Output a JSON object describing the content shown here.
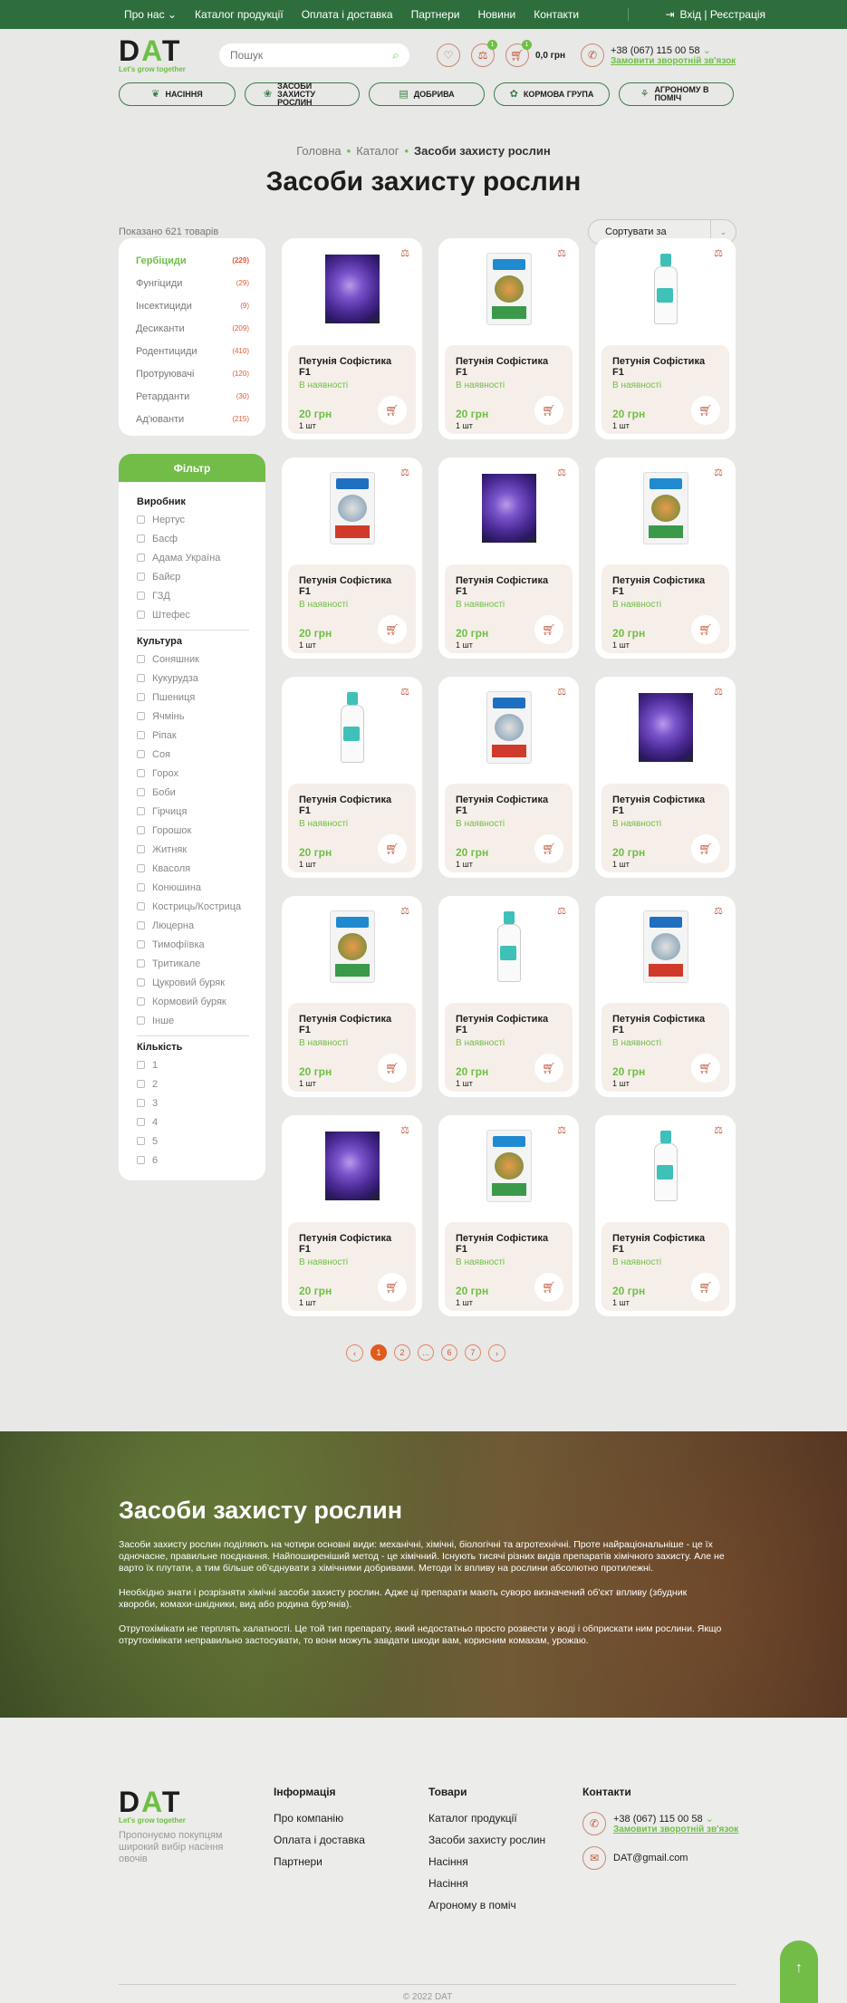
{
  "topnav": {
    "items": [
      "Про нас",
      "Каталог продукції",
      "Оплата і доставка",
      "Партнери",
      "Новини",
      "Контакти"
    ],
    "login": "Вхід | Реєстрація"
  },
  "header": {
    "logo_text": "DAT",
    "tagline": "Let's grow together",
    "search_placeholder": "Пошук",
    "favorites_badge": "",
    "compare_badge": "1",
    "cart_badge": "1",
    "cart_sum": "0,0 грн",
    "phone": "+38 (067) 115 00 58",
    "callback": "Замовити зворотній зв'язок"
  },
  "categories": [
    {
      "label": "Насіння",
      "icon": "seedling-icon"
    },
    {
      "label": "Засоби захисту рослин",
      "icon": "plant-protection-icon"
    },
    {
      "label": "Добрива",
      "icon": "fertilizer-icon"
    },
    {
      "label": "Кормова група",
      "icon": "feed-icon"
    },
    {
      "label": "Агроному в поміч",
      "icon": "agronomist-icon"
    }
  ],
  "breadcrumb": {
    "home": "Головна",
    "catalog": "Каталог",
    "current": "Засоби захисту рослин"
  },
  "page_title": "Засоби захисту рослин",
  "results_count": "Показано 621 товарів",
  "sort_label": "Сортувати за",
  "sidebar_categories": [
    {
      "label": "Гербіциди",
      "count": "(229)",
      "active": true
    },
    {
      "label": "Фунгіциди",
      "count": "(29)"
    },
    {
      "label": "Інсектициди",
      "count": "(9)"
    },
    {
      "label": "Десиканти",
      "count": "(209)"
    },
    {
      "label": "Родентициди",
      "count": "(410)"
    },
    {
      "label": "Протруювачі",
      "count": "(120)"
    },
    {
      "label": "Ретарданти",
      "count": "(30)"
    },
    {
      "label": "Ад'юванти",
      "count": "(215)"
    }
  ],
  "filter": {
    "title": "Фільтр",
    "groups": [
      {
        "title": "Виробник",
        "options": [
          "Нертус",
          "Басф",
          "Адама Україна",
          "Байєр",
          "ГЗД",
          "Штефес"
        ]
      },
      {
        "title": "Культура",
        "options": [
          "Соняшник",
          "Кукурудза",
          "Пшениця",
          "Ячмінь",
          "Ріпак",
          "Соя",
          "Горох",
          "Боби",
          "Гірчиця",
          "Горошок",
          "Житняк",
          "Квасоля",
          "Конюшина",
          "Костриць/Кострица",
          "Люцерна",
          "Тимофіївка",
          "Тритикале",
          "Цукровий буряк",
          "Кормовий буряк",
          "Інше"
        ]
      },
      {
        "title": "Кількість",
        "options": [
          "1",
          "2",
          "3",
          "4",
          "5",
          "6"
        ]
      }
    ]
  },
  "products": [
    {
      "name": "Петунія Софістика F1",
      "availability": "В наявності",
      "price": "20 грн",
      "unit": "1 шт",
      "image": "flower"
    },
    {
      "name": "Петунія Софістика F1",
      "availability": "В наявності",
      "price": "20 грн",
      "unit": "1 шт",
      "image": "skor"
    },
    {
      "name": "Петунія Софістика F1",
      "availability": "В наявності",
      "price": "20 грн",
      "unit": "1 шт",
      "image": "bottle"
    },
    {
      "name": "Петунія Софістика F1",
      "availability": "В наявності",
      "price": "20 грн",
      "unit": "1 шт",
      "image": "horus"
    },
    {
      "name": "Петунія Софістика F1",
      "availability": "В наявності",
      "price": "20 грн",
      "unit": "1 шт",
      "image": "flower"
    },
    {
      "name": "Петунія Софістика F1",
      "availability": "В наявності",
      "price": "20 грн",
      "unit": "1 шт",
      "image": "skor"
    },
    {
      "name": "Петунія Софістика F1",
      "availability": "В наявності",
      "price": "20 грн",
      "unit": "1 шт",
      "image": "bottle"
    },
    {
      "name": "Петунія Софістика F1",
      "availability": "В наявності",
      "price": "20 грн",
      "unit": "1 шт",
      "image": "horus"
    },
    {
      "name": "Петунія Софістика F1",
      "availability": "В наявності",
      "price": "20 грн",
      "unit": "1 шт",
      "image": "flower"
    },
    {
      "name": "Петунія Софістика F1",
      "availability": "В наявності",
      "price": "20 грн",
      "unit": "1 шт",
      "image": "skor"
    },
    {
      "name": "Петунія Софістика F1",
      "availability": "В наявності",
      "price": "20 грн",
      "unit": "1 шт",
      "image": "bottle"
    },
    {
      "name": "Петунія Софістика F1",
      "availability": "В наявності",
      "price": "20 грн",
      "unit": "1 шт",
      "image": "horus"
    },
    {
      "name": "Петунія Софістика F1",
      "availability": "В наявності",
      "price": "20 грн",
      "unit": "1 шт",
      "image": "flower"
    },
    {
      "name": "Петунія Софістика F1",
      "availability": "В наявності",
      "price": "20 грн",
      "unit": "1 шт",
      "image": "skor"
    },
    {
      "name": "Петунія Софістика F1",
      "availability": "В наявності",
      "price": "20 грн",
      "unit": "1 шт",
      "image": "bottle"
    }
  ],
  "pagination": {
    "pages": [
      "1",
      "2",
      "...",
      "6",
      "7"
    ],
    "current": "1"
  },
  "seo": {
    "title": "Засоби захисту рослин",
    "paragraphs": [
      "Засоби захисту рослин поділяють на чотири основні види: механічні, хімічні, біологічні та агротехнічні. Проте найраціональніше - це їх одночасне, правильне поєднання. Найпоширеніший метод - це хімічний. Існують тисячі різних видів препаратів хімічного захисту. Але не варто їх плутати, а тим більше об'єднувати з хімічними добривами. Методи їх впливу на рослини абсолютно протилежні.",
      "Необхідно знати і розрізняти хімічні засоби захисту рослин. Адже ці препарати мають суворо визначений об'єкт впливу (збудник хвороби, комахи-шкідники, вид або родина бур'янів).",
      "Отрутохімікати не терплять халатності. Це той тип препарату, який недостатньо просто розвести у воді і обприскати ним рослини. Якщо отрутохімікати неправильно застосувати, то вони можуть завдати шкоди вам, корисним комахам, урожаю."
    ]
  },
  "footer": {
    "logo_text": "DAT",
    "tagline": "Let's grow together",
    "description": "Пропонуємо покупцям широкий вибір насіння овочів",
    "info_title": "Інформація",
    "info_links": [
      "Про компанію",
      "Оплата і доставка",
      "Партнери"
    ],
    "goods_title": "Товари",
    "goods_links": [
      "Каталог продукції",
      "Засоби захисту рослин",
      "Насіння",
      "Насіння",
      "Агроному в поміч"
    ],
    "contacts_title": "Контакти",
    "phone": "+38 (067) 115 00 58",
    "callback": "Замовити зворотній зв'язок",
    "email": "DAT@gmail.com",
    "copyright": "© 2022 DAT"
  },
  "colors": {
    "brand_green": "#6ebf45",
    "dark_green": "#2e6e3d",
    "accent_orange": "#e05b1a"
  }
}
